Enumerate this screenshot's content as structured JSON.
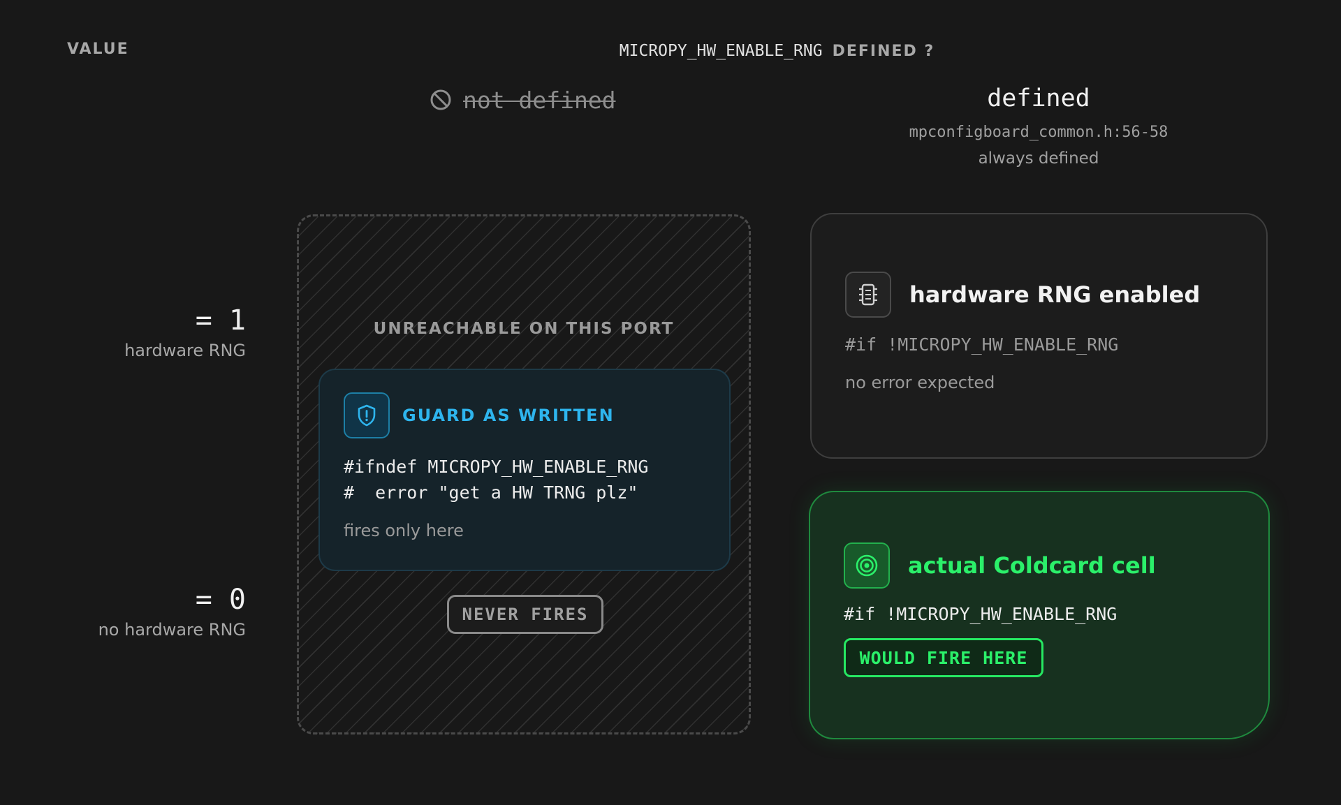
{
  "header": {
    "value_label": "VALUE",
    "macro": "MICROPY_HW_ENABLE_RNG",
    "question_suffix": "DEFINED ?"
  },
  "columns": {
    "not_defined": {
      "label": "not defined",
      "icon": "prohibited-icon"
    },
    "defined": {
      "label": "defined",
      "source": "mpconfigboard_common.h:56-58",
      "note": "always defined"
    }
  },
  "rows": [
    {
      "value": "= 1",
      "description": "hardware RNG"
    },
    {
      "value": "= 0",
      "description": "no hardware RNG"
    }
  ],
  "unreachable": {
    "label": "UNREACHABLE ON THIS PORT",
    "guard_card": {
      "icon": "shield-alert-icon",
      "title": "GUARD AS WRITTEN",
      "code_lines": [
        "#ifndef MICROPY_HW_ENABLE_RNG",
        "#  error \"get a HW TRNG plz\""
      ],
      "footnote": "fires only here"
    },
    "badge": "NEVER FIRES"
  },
  "hw_card": {
    "icon": "chip-icon",
    "title": "hardware RNG enabled",
    "code": "#if !MICROPY_HW_ENABLE_RNG",
    "footnote": "no error expected"
  },
  "cold_card": {
    "icon": "target-icon",
    "title": "actual Coldcard cell",
    "code": "#if !MICROPY_HW_ENABLE_RNG",
    "badge": "WOULD FIRE HERE"
  },
  "colors": {
    "background": "#181818",
    "guard_accent": "#2eb5ee",
    "fire_accent": "#2bf06a"
  }
}
